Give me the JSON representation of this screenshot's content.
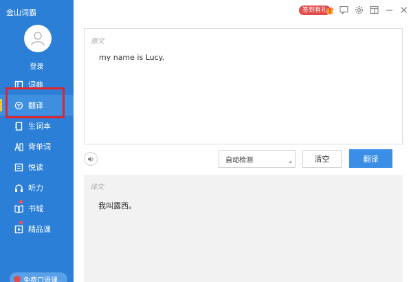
{
  "app": {
    "title": "金山词霸"
  },
  "user": {
    "login_label": "登录"
  },
  "sidebar": {
    "items": [
      {
        "label": "词典",
        "icon": "dictionary-icon"
      },
      {
        "label": "翻译",
        "icon": "translate-icon",
        "active": true
      },
      {
        "label": "生词本",
        "icon": "wordbook-icon"
      },
      {
        "label": "背单词",
        "icon": "memorize-icon"
      },
      {
        "label": "悦读",
        "icon": "reading-icon"
      },
      {
        "label": "听力",
        "icon": "headphones-icon"
      },
      {
        "label": "书城",
        "icon": "bookstore-icon"
      },
      {
        "label": "精品课",
        "icon": "course-icon"
      }
    ],
    "bottom_pill": "免费口语课"
  },
  "titlebar": {
    "sign_badge": "签到有礼",
    "icons": [
      "gift-icon",
      "feedback-icon",
      "settings-icon",
      "skin-icon",
      "minimize-icon",
      "close-icon"
    ]
  },
  "source": {
    "label": "原文",
    "text": "my name is Lucy."
  },
  "controls": {
    "language_select": "自动检测",
    "clear_label": "清空",
    "translate_label": "翻译"
  },
  "result": {
    "label": "译文",
    "text": "我叫露西。"
  },
  "colors": {
    "sidebar": "#2b7fd6",
    "accent": "#3b8ee6",
    "highlight": "#e3232c",
    "badge": "#e34a4a"
  }
}
